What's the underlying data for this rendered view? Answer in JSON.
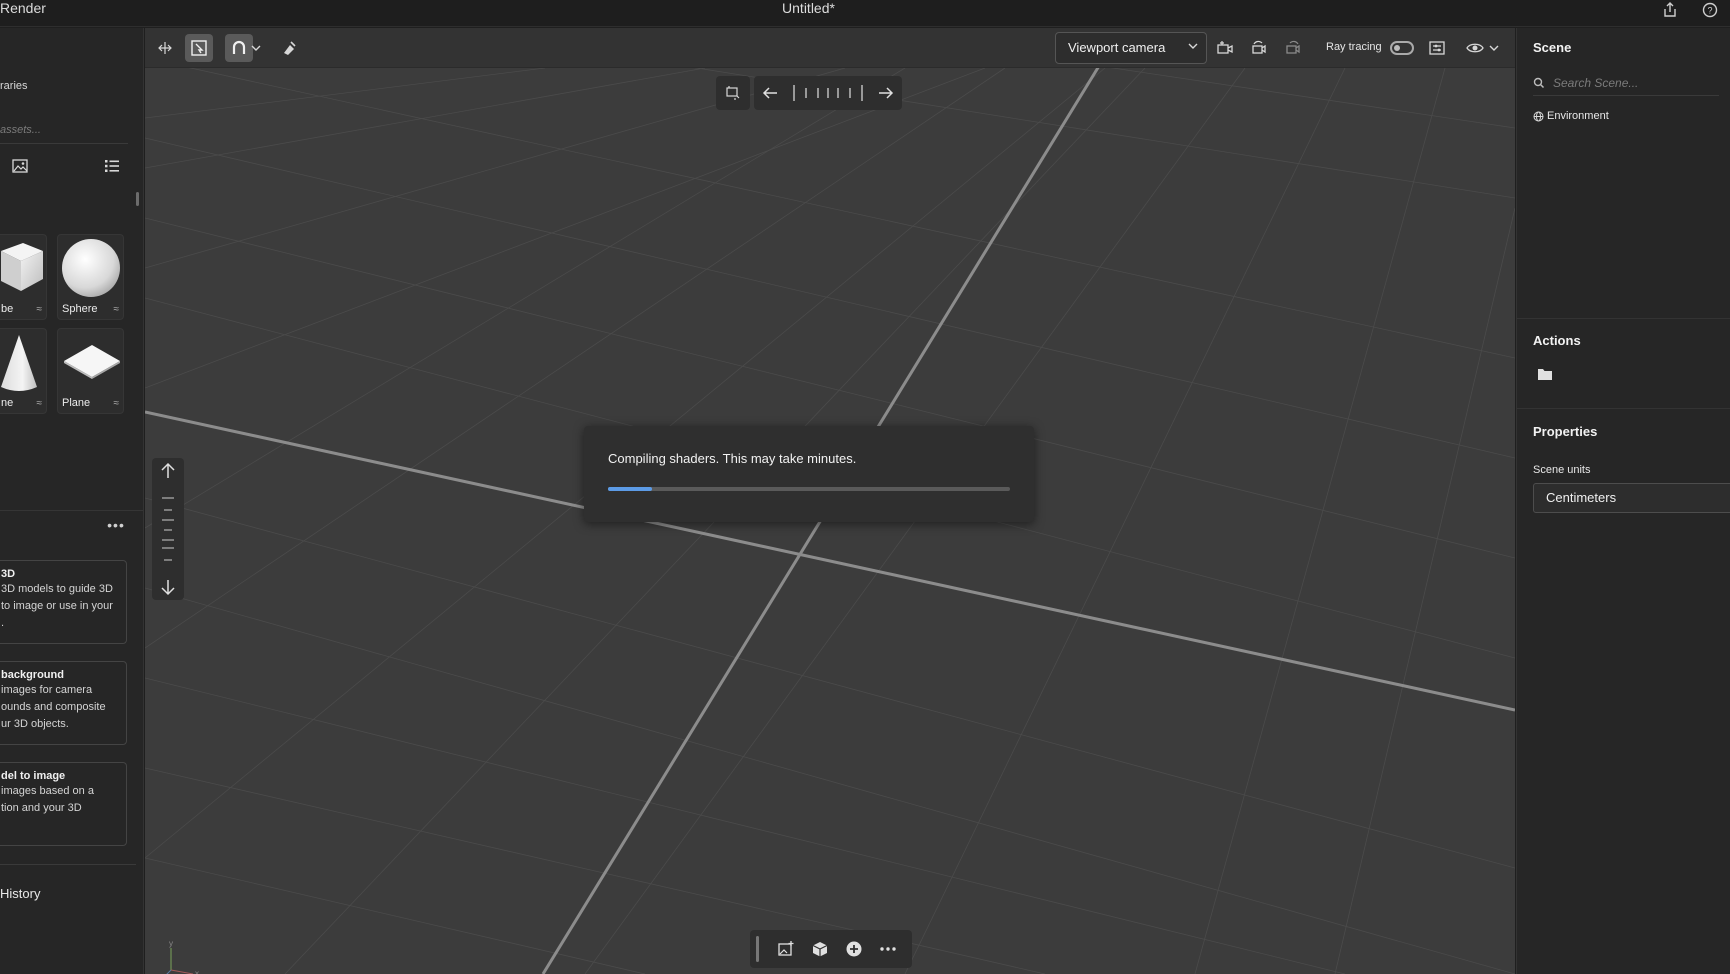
{
  "titlebar": {
    "app_name": "Render",
    "doc_title": "Untitled*",
    "icons": [
      "share-icon",
      "help-icon"
    ]
  },
  "left_panel": {
    "libraries_label": "raries",
    "asset_search_placeholder": "assets...",
    "view_icons": [
      "image-view-icon",
      "list-view-icon"
    ],
    "primitives": [
      {
        "label": "be"
      },
      {
        "label": "Sphere"
      },
      {
        "label": "ne"
      },
      {
        "label": "Plane"
      }
    ],
    "cards": [
      {
        "title": "3D",
        "desc": [
          "3D models to guide 3D",
          "to image or use in your",
          "."
        ]
      },
      {
        "title": "background",
        "desc": [
          "images for camera",
          "ounds and composite",
          "ur 3D objects."
        ]
      },
      {
        "title": "del to image",
        "desc": [
          "images based on a",
          "tion and your 3D",
          ""
        ]
      }
    ],
    "history_label": "History"
  },
  "viewport_toolbar": {
    "tools": [
      "select-transform-icon",
      "frame-select-icon",
      "magnet-snap-icon",
      "chevron-down-icon",
      "clear-scene-icon"
    ],
    "camera_select": "Viewport camera",
    "camera_icons": [
      "add-camera-icon",
      "rotate-camera-icon",
      "reset-camera-icon"
    ],
    "ray_tracing_label": "Ray tracing",
    "ray_tracing_on": false,
    "right_icons": [
      "render-settings-icon",
      "visibility-eye-icon",
      "chevron-down-icon"
    ]
  },
  "nav_control": {
    "icons": [
      "fit-view-icon",
      "arrow-left-icon",
      "dial-ticks",
      "arrow-right-icon"
    ]
  },
  "zoom_control": {
    "icons": [
      "arrow-up-icon",
      "arrow-down-icon"
    ]
  },
  "dialog": {
    "message": "Compiling shaders. This may take minutes.",
    "progress": 0.11
  },
  "bottom_toolbar": {
    "icons": [
      "add-image-icon",
      "add-3d-object-icon",
      "add-plus-icon",
      "more-icon"
    ]
  },
  "right_panel": {
    "scene_title": "Scene",
    "scene_search_placeholder": "Search Scene...",
    "environment_label": "Environment",
    "actions_title": "Actions",
    "properties_title": "Properties",
    "scene_units_label": "Scene units",
    "scene_units_value": "Centimeters"
  },
  "colors": {
    "accent_progress": "#5c9be6",
    "viewport_bg": "#3c3c3c",
    "panel_bg": "#262626"
  }
}
